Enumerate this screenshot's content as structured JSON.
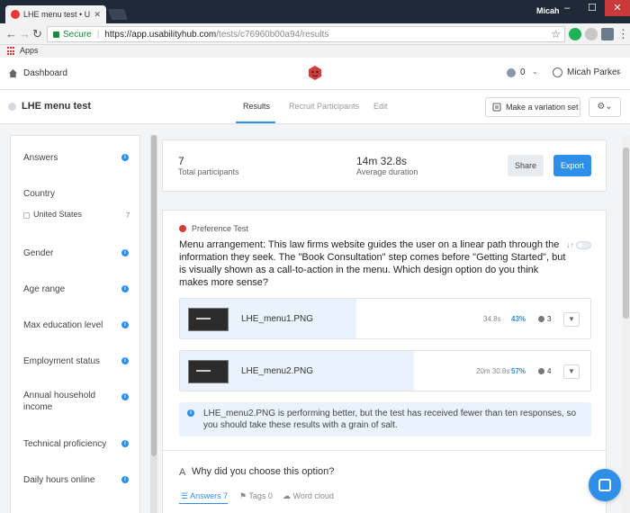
{
  "browser": {
    "tab_title": "LHE menu test • Usability",
    "tab_close": "✕",
    "profile_name": "Micah",
    "window_minimize": "–",
    "window_maximize": "☐",
    "window_close": "✕",
    "secure_label": "Secure",
    "url_host": "https://app.usabilityhub.com",
    "url_path": "/tests/c76960b00a94/results",
    "bookmark_apps": "Apps"
  },
  "header": {
    "dashboard_label": "Dashboard",
    "notification_count": "0",
    "user_name": "Micah Parker",
    "chevron": "⌄"
  },
  "subheader": {
    "test_name": "LHE menu test",
    "tabs": [
      {
        "label": "Results",
        "active": true
      },
      {
        "label": "Recruit Participants",
        "active": false
      },
      {
        "label": "Edit",
        "active": false
      }
    ],
    "variation_button": "Make a variation set",
    "gear_button": "⚙⌄"
  },
  "sidebar": {
    "answers": "Answers",
    "country": "Country",
    "country_value": "United States",
    "country_count": "7",
    "filters": [
      "Gender",
      "Age range",
      "Max education level",
      "Employment status",
      "Annual household income",
      "Technical proficiency",
      "Daily hours online"
    ],
    "info_glyph": "i"
  },
  "stats": {
    "participants_value": "7",
    "participants_label": "Total participants",
    "duration_value": "14m 32.8s",
    "duration_label": "Average duration",
    "share": "Share",
    "export": "Export"
  },
  "preference": {
    "type_label": "Preference Test",
    "question": "Menu arrangement: This law firms website guides the user on a linear path through the information they seek. The \"Book Consultation\" step comes before \"Getting Started\", but is visually shown as a call-to-action in the menu. Which design option do you think makes more sense?",
    "sort_glyph": "↓↑",
    "options": [
      {
        "name": "LHE_menu1.PNG",
        "time": "34.8s",
        "percent": "43%",
        "share": 0.43,
        "count": "3"
      },
      {
        "name": "LHE_menu2.PNG",
        "time": "20m 30.8s",
        "percent": "57%",
        "share": 0.57,
        "count": "4"
      }
    ],
    "filter_glyph": "▼",
    "notice": "LHE_menu2.PNG is performing better, but the test has received fewer than ten responses, so you should take these results with a grain of salt.",
    "followup_icon": "A",
    "followup_question": "Why did you choose this option?",
    "followup_tabs": [
      "☰ Answers 7",
      "⚑ Tags 0",
      "☁ Word cloud"
    ]
  },
  "colors": {
    "accent": "#2d8fe8",
    "brand_red": "#d93a3a",
    "chrome_dark": "#1e2a38",
    "option_fill": "#eaf3fc"
  }
}
